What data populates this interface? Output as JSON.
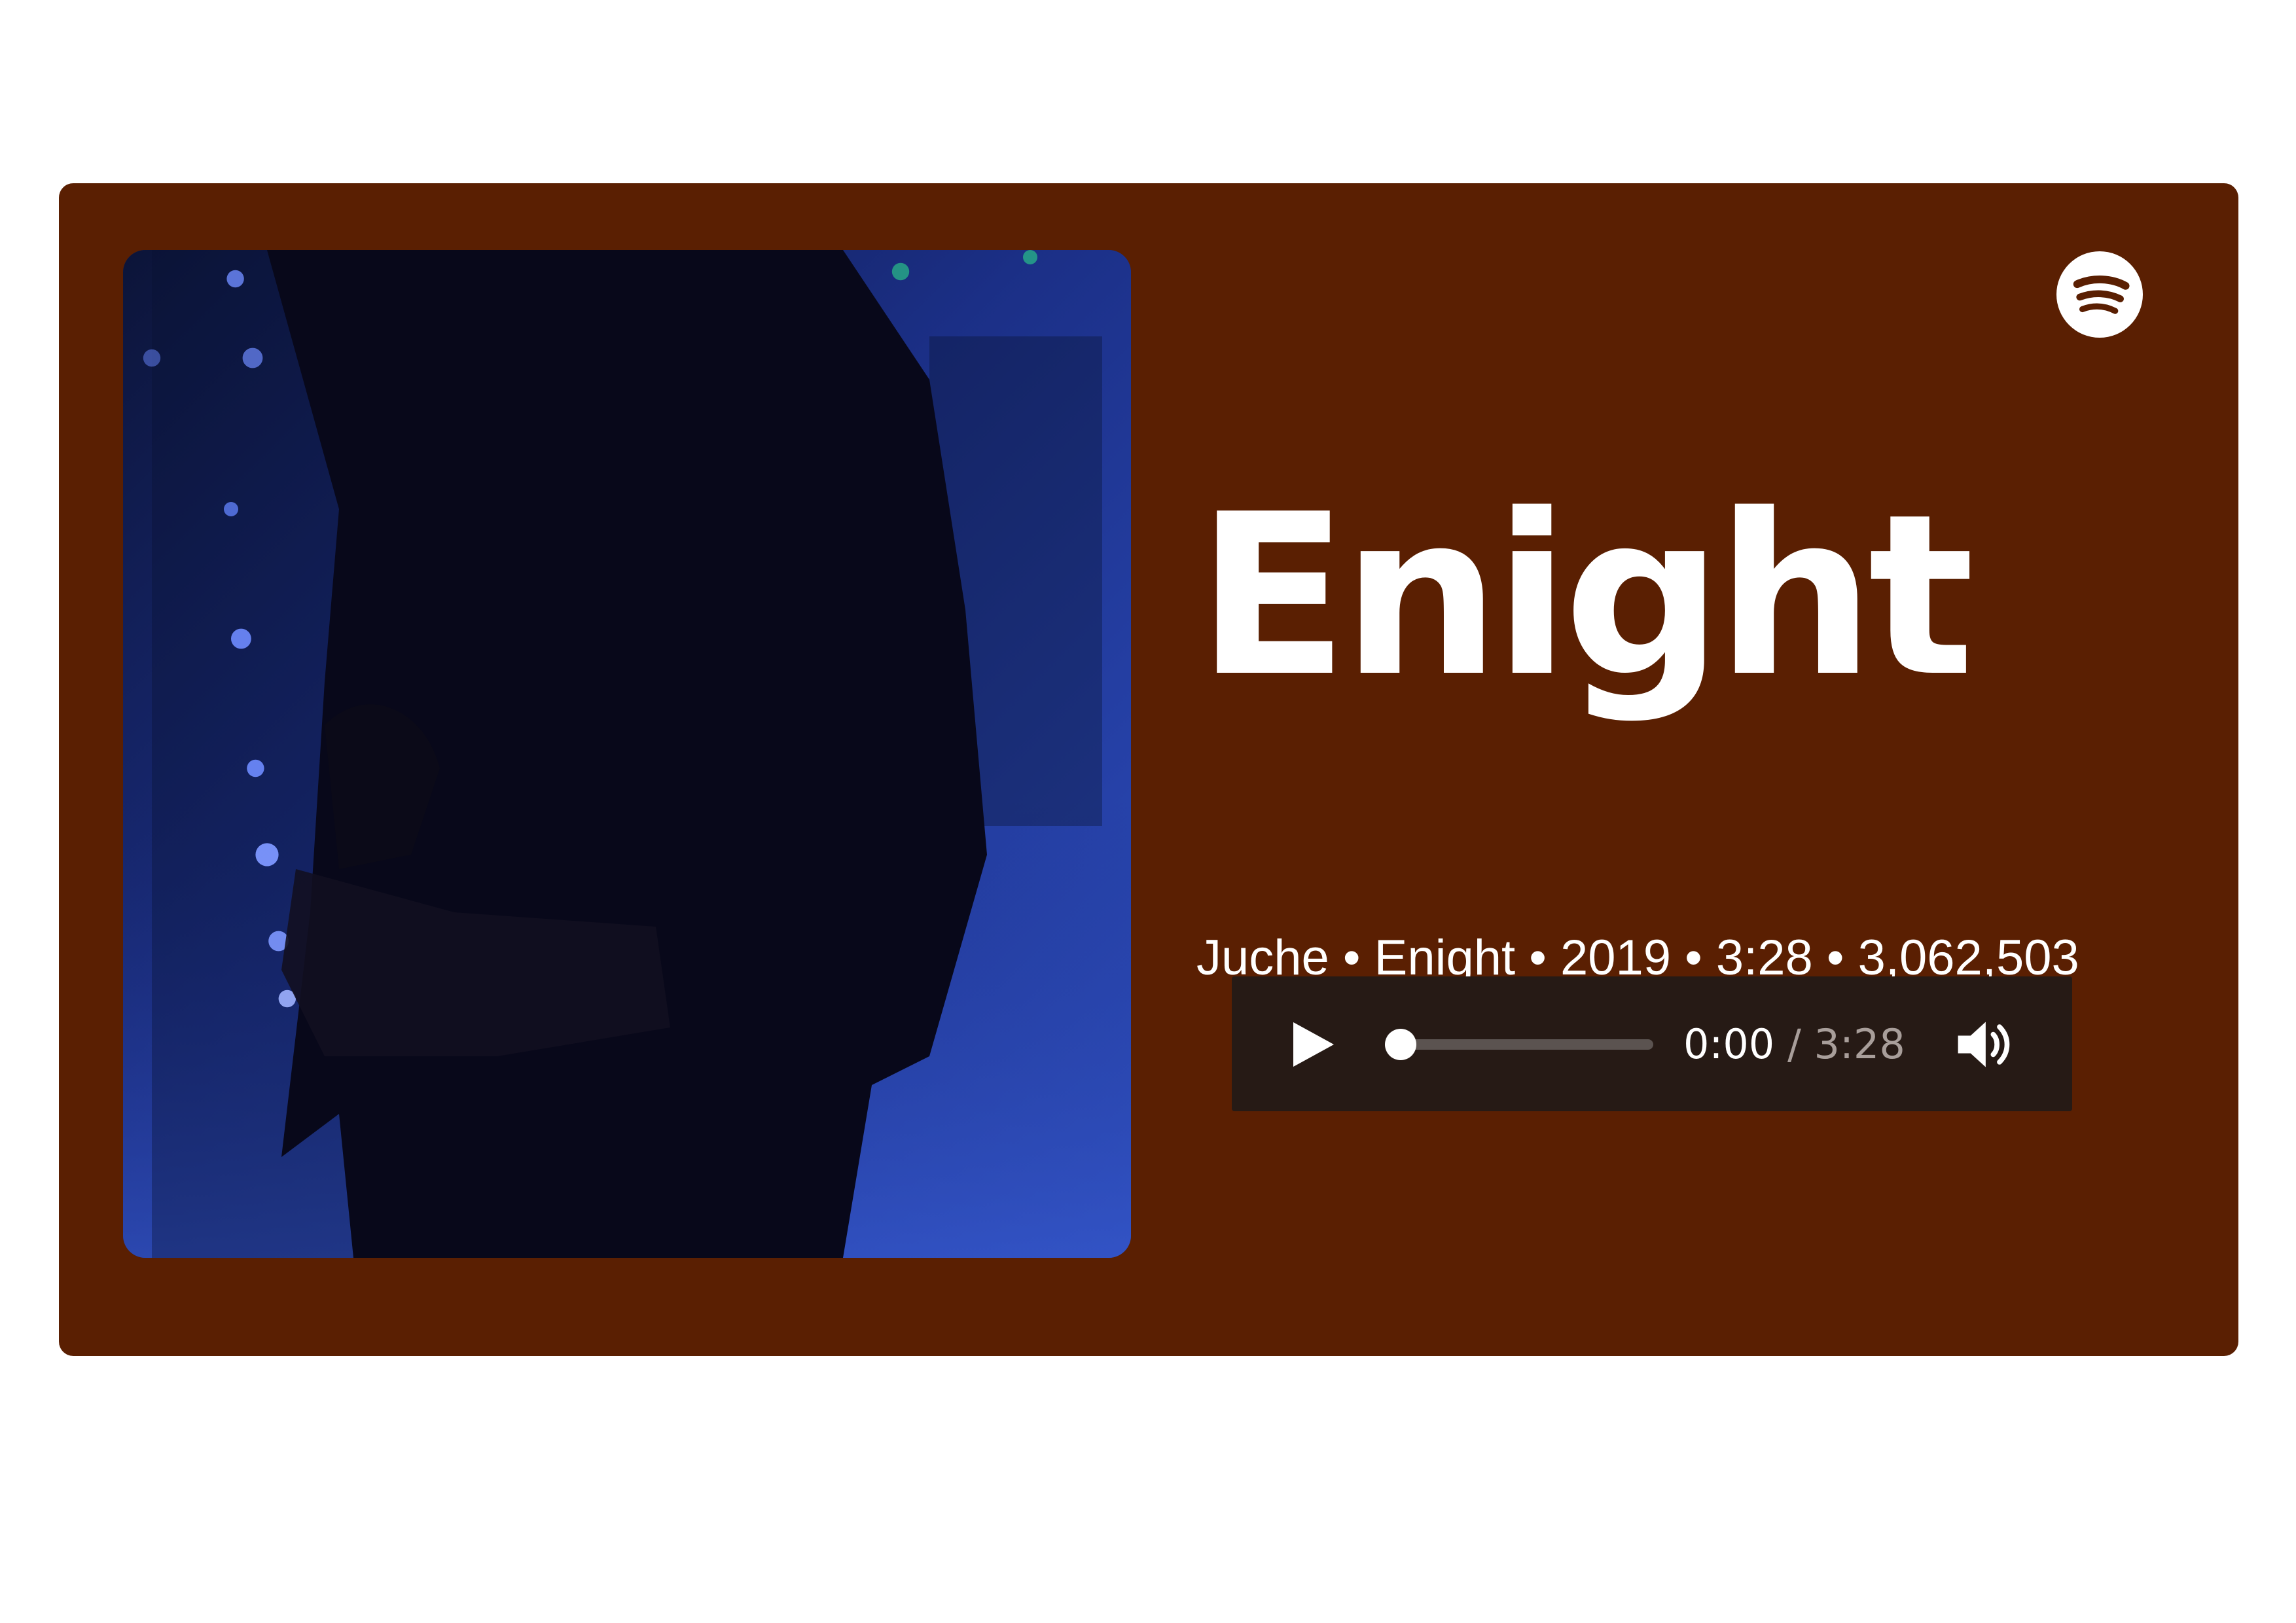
{
  "colors": {
    "card_background": "#5a1f02",
    "player_background": "#261a15",
    "text": "#ffffff",
    "muted_text": "#a89e9a"
  },
  "track": {
    "title": "Enight",
    "meta": "Juche • Enight • 2019 • 3:28 • 3,062,503"
  },
  "cover_art": {
    "icon": "album-cover-image"
  },
  "brand": {
    "icon": "spotify-logo-icon"
  },
  "player": {
    "play_icon": "play-icon",
    "current_time": "0:00",
    "separator": " / ",
    "total_time": "3:28",
    "progress": 0,
    "volume_icon": "volume-icon"
  }
}
